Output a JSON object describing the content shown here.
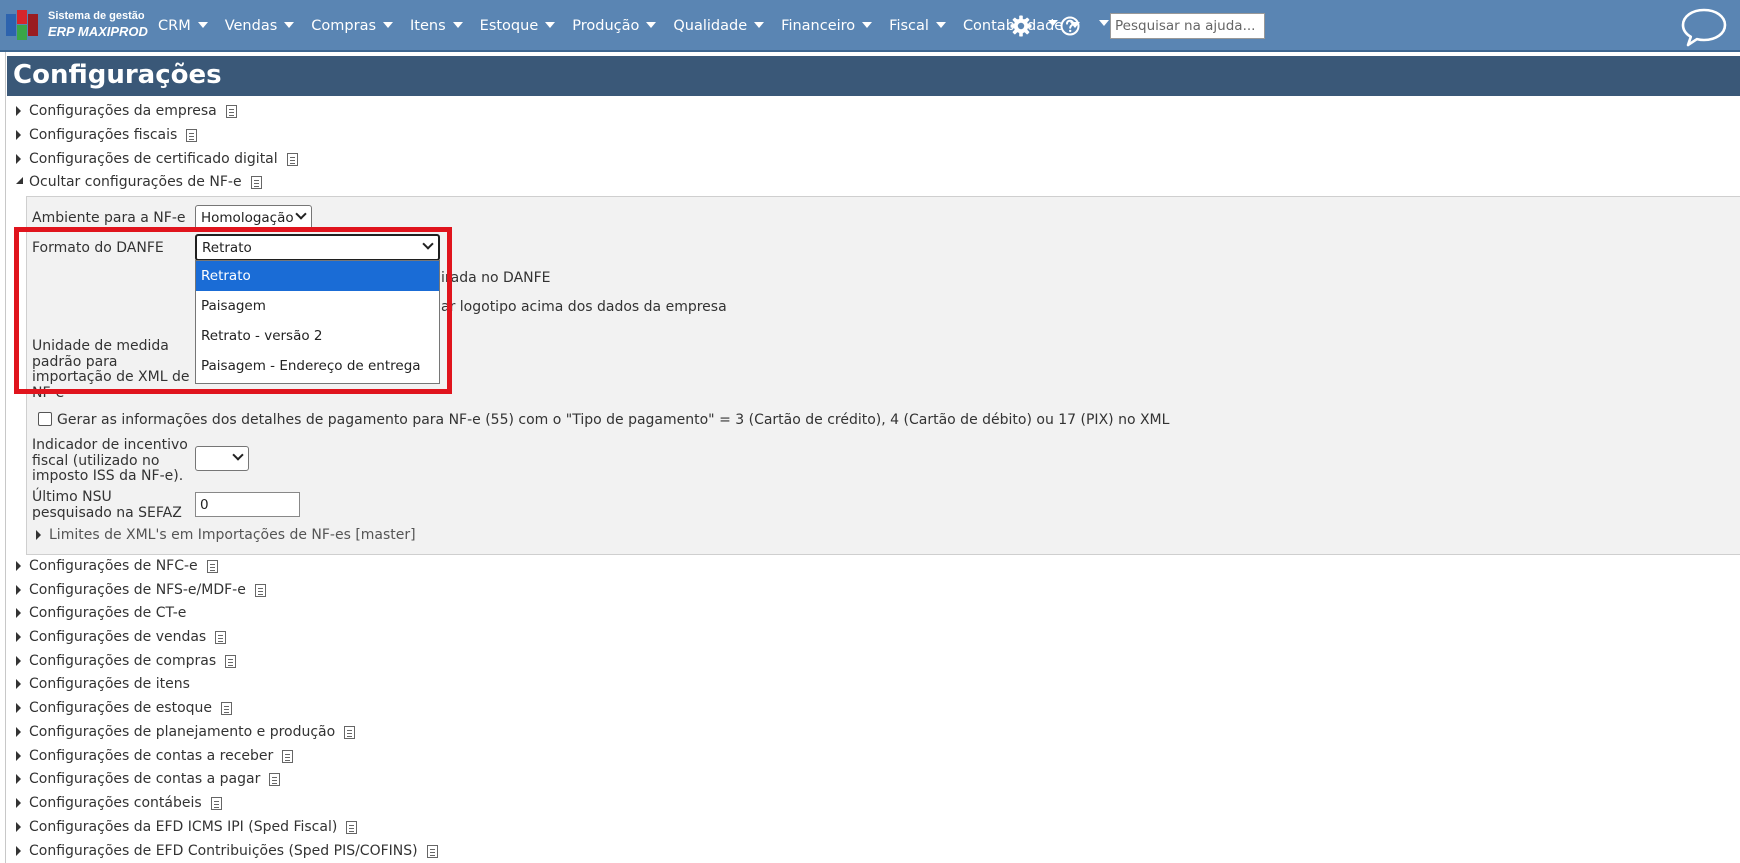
{
  "brand": {
    "line1": "Sistema de gestão",
    "line2": "ERP MAXIPROD",
    "colors": {
      "red": "#d7262b",
      "green": "#3aa647",
      "blue": "#2d63ae",
      "dark_red": "#9a1c20"
    }
  },
  "nav": {
    "items": [
      {
        "label": "CRM"
      },
      {
        "label": "Vendas"
      },
      {
        "label": "Compras"
      },
      {
        "label": "Itens"
      },
      {
        "label": "Estoque"
      },
      {
        "label": "Produção"
      },
      {
        "label": "Qualidade"
      },
      {
        "label": "Financeiro"
      },
      {
        "label": "Fiscal"
      },
      {
        "label": "Contabilidade"
      }
    ],
    "settings_icon": "gear-icon",
    "help_icon": "question-circle-icon",
    "search_placeholder": "Pesquisar na ajuda...",
    "chat_icon": "speech-bubble-icon",
    "bar_color": "#5a85b3"
  },
  "page": {
    "title": "Configurações",
    "title_bar_color": "#3a5878"
  },
  "sections_top": [
    {
      "label": "Configurações da empresa",
      "has_doc": true
    },
    {
      "label": "Configurações fiscais",
      "has_doc": true
    },
    {
      "label": "Configurações de certificado digital",
      "has_doc": true
    }
  ],
  "nfe": {
    "header": "Ocultar configurações de NF-e",
    "ambiente_label": "Ambiente para a NF-e",
    "ambiente_value": "Homologação",
    "danfe_label": "Formato do DANFE",
    "danfe_value": "Retrato",
    "danfe_options": [
      "Retrato",
      "Paisagem",
      "Retrato - versão 2",
      "Paisagem - Endereço de entrega"
    ],
    "danfe_selected_index": 0,
    "hidden_text_1": "irada no DANFE",
    "hidden_text_2": "ar logotipo acima dos dados da empresa",
    "unidade_label_l1": "Unidade de medida",
    "unidade_label_l2": "padrão para",
    "unidade_label_l3": "importação de XML de",
    "unidade_label_l4": "NF-e",
    "pagamento_checkbox_label": "Gerar as informações dos detalhes de pagamento para NF-e (55) com o \"Tipo de pagamento\" = 3 (Cartão de crédito), 4 (Cartão de débito) ou 17 (PIX) no XML",
    "pagamento_checked": false,
    "incentivo_label_l1": "Indicador de incentivo",
    "incentivo_label_l2": "fiscal (utilizado no",
    "incentivo_label_l3": "imposto ISS da NF-e).",
    "incentivo_value": "",
    "nsu_label_l1": "Último NSU",
    "nsu_label_l2": "pesquisado na SEFAZ",
    "nsu_value": "0",
    "limites_label": "Limites de XML's em Importações de NF-es [master]"
  },
  "sections_bottom": [
    {
      "label": "Configurações de NFC-e",
      "has_doc": true
    },
    {
      "label": "Configurações de NFS-e/MDF-e",
      "has_doc": true
    },
    {
      "label": "Configurações de CT-e",
      "has_doc": false
    },
    {
      "label": "Configurações de vendas",
      "has_doc": true
    },
    {
      "label": "Configurações de compras",
      "has_doc": true
    },
    {
      "label": "Configurações de itens",
      "has_doc": false
    },
    {
      "label": "Configurações de estoque",
      "has_doc": true
    },
    {
      "label": "Configurações de planejamento e produção",
      "has_doc": true
    },
    {
      "label": "Configurações de contas a receber",
      "has_doc": true
    },
    {
      "label": "Configurações de contas a pagar",
      "has_doc": true
    },
    {
      "label": "Configurações contábeis",
      "has_doc": true
    },
    {
      "label": "Configurações da EFD ICMS IPI (Sped Fiscal)",
      "has_doc": true
    },
    {
      "label": "Configurações de EFD Contribuições (Sped PIS/COFINS)",
      "has_doc": true
    }
  ],
  "annotation": {
    "highlight_color": "#e0141d"
  }
}
